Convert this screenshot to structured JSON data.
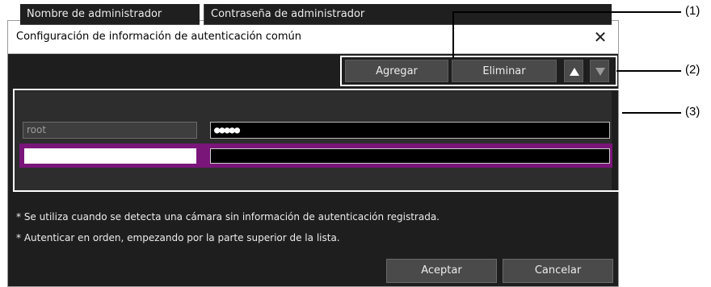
{
  "dialog": {
    "title": "Configuración de información de autenticación común",
    "close_glyph": "✕"
  },
  "toolbar": {
    "add_label": "Agregar",
    "delete_label": "Eliminar",
    "up_icon": "triangle-up-icon",
    "down_icon": "triangle-down-icon"
  },
  "table": {
    "headers": [
      "Nombre de administrador",
      "Contraseña de administrador"
    ],
    "rows": [
      {
        "user": "root",
        "password": "●●●●●"
      }
    ],
    "selected_row": {
      "user": "",
      "password": ""
    }
  },
  "notes": [
    "* Se utiliza cuando se detecta una cámara sin información de autenticación registrada.",
    "* Autenticar en orden, empezando por la parte superior de la lista."
  ],
  "footer": {
    "ok_label": "Aceptar",
    "cancel_label": "Cancelar"
  },
  "callouts": [
    "(1)",
    "(2)",
    "(3)"
  ],
  "colors": {
    "dialog_bg": "#1e1e1e",
    "selected_row": "#7a157a",
    "button_bg": "#4a4a4a"
  }
}
